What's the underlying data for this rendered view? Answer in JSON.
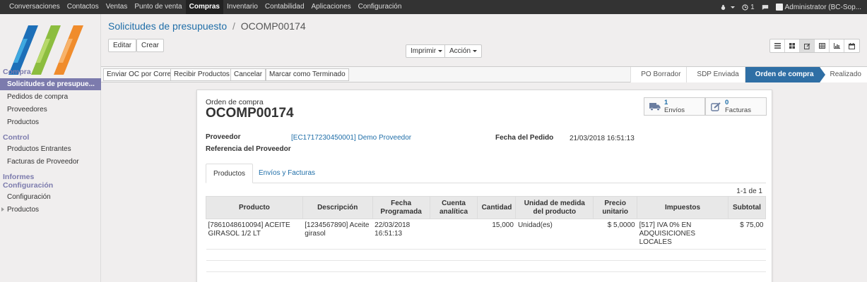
{
  "topbar": {
    "menu": [
      "Conversaciones",
      "Contactos",
      "Ventas",
      "Punto de venta",
      "Compras",
      "Inventario",
      "Contabilidad",
      "Aplicaciones",
      "Configuración"
    ],
    "active_menu": "Compras",
    "notification_count": "1",
    "user": "Administrator (BC-Sop..."
  },
  "sidebar": {
    "sections": {
      "compra": "Compra",
      "control": "Control",
      "informes": "Informes",
      "configuracion": "Configuración"
    },
    "items": {
      "solicitudes": "Solicitudes de presupue...",
      "pedidos": "Pedidos de compra",
      "proveedores": "Proveedores",
      "productos": "Productos",
      "productos_entrantes": "Productos Entrantes",
      "facturas_proveedor": "Facturas de Proveedor",
      "config_configuracion": "Configuración",
      "config_productos": "Productos"
    }
  },
  "breadcrumb": {
    "parent": "Solicitudes de presupuesto",
    "separator": "/",
    "current": "OCOMP00174"
  },
  "buttons": {
    "edit": "Editar",
    "create": "Crear",
    "print": "Imprimir",
    "action": "Acción"
  },
  "statusbar": {
    "actions": [
      "Enviar OC por Correo",
      "Recibir Productos",
      "Cancelar",
      "Marcar como Terminado"
    ],
    "stages": [
      "PO Borrador",
      "SDP Enviada",
      "Orden de compra",
      "Realizado"
    ],
    "active_stage": "Orden de compra"
  },
  "form": {
    "doc_kind": "Orden de compra",
    "doc_name": "OCOMP00174",
    "smart_buttons": {
      "envios_count": "1",
      "envios_label": "Envíos",
      "facturas_count": "0",
      "facturas_label": "Facturas"
    },
    "fields": {
      "proveedor_label": "Proveedor",
      "proveedor_value": "[EC1717230450001] Demo Proveedor",
      "referencia_label": "Referencia del Proveedor",
      "fecha_label": "Fecha del Pedido",
      "fecha_value": "21/03/2018 16:51:13"
    },
    "tabs": [
      "Productos",
      "Envíos y Facturas"
    ],
    "pager": "1-1 de 1",
    "table": {
      "headers": [
        "Producto",
        "Descripción",
        "Fecha Programada",
        "Cuenta analítica",
        "Cantidad",
        "Unidad de medida del producto",
        "Precio unitario",
        "Impuestos",
        "Subtotal"
      ],
      "rows": [
        {
          "producto": "[7861048610094] ACEITE GIRASOL 1/2 LT",
          "descripcion": "[1234567890] Aceite girasol",
          "fecha": "22/03/2018 16:51:13",
          "cuenta": "",
          "cantidad": "15,000",
          "unidad": "Unidad(es)",
          "precio": "$ 5,0000",
          "impuestos": "[517] IVA 0% EN ADQUISICIONES LOCALES",
          "subtotal": "$ 75,00"
        }
      ]
    }
  }
}
